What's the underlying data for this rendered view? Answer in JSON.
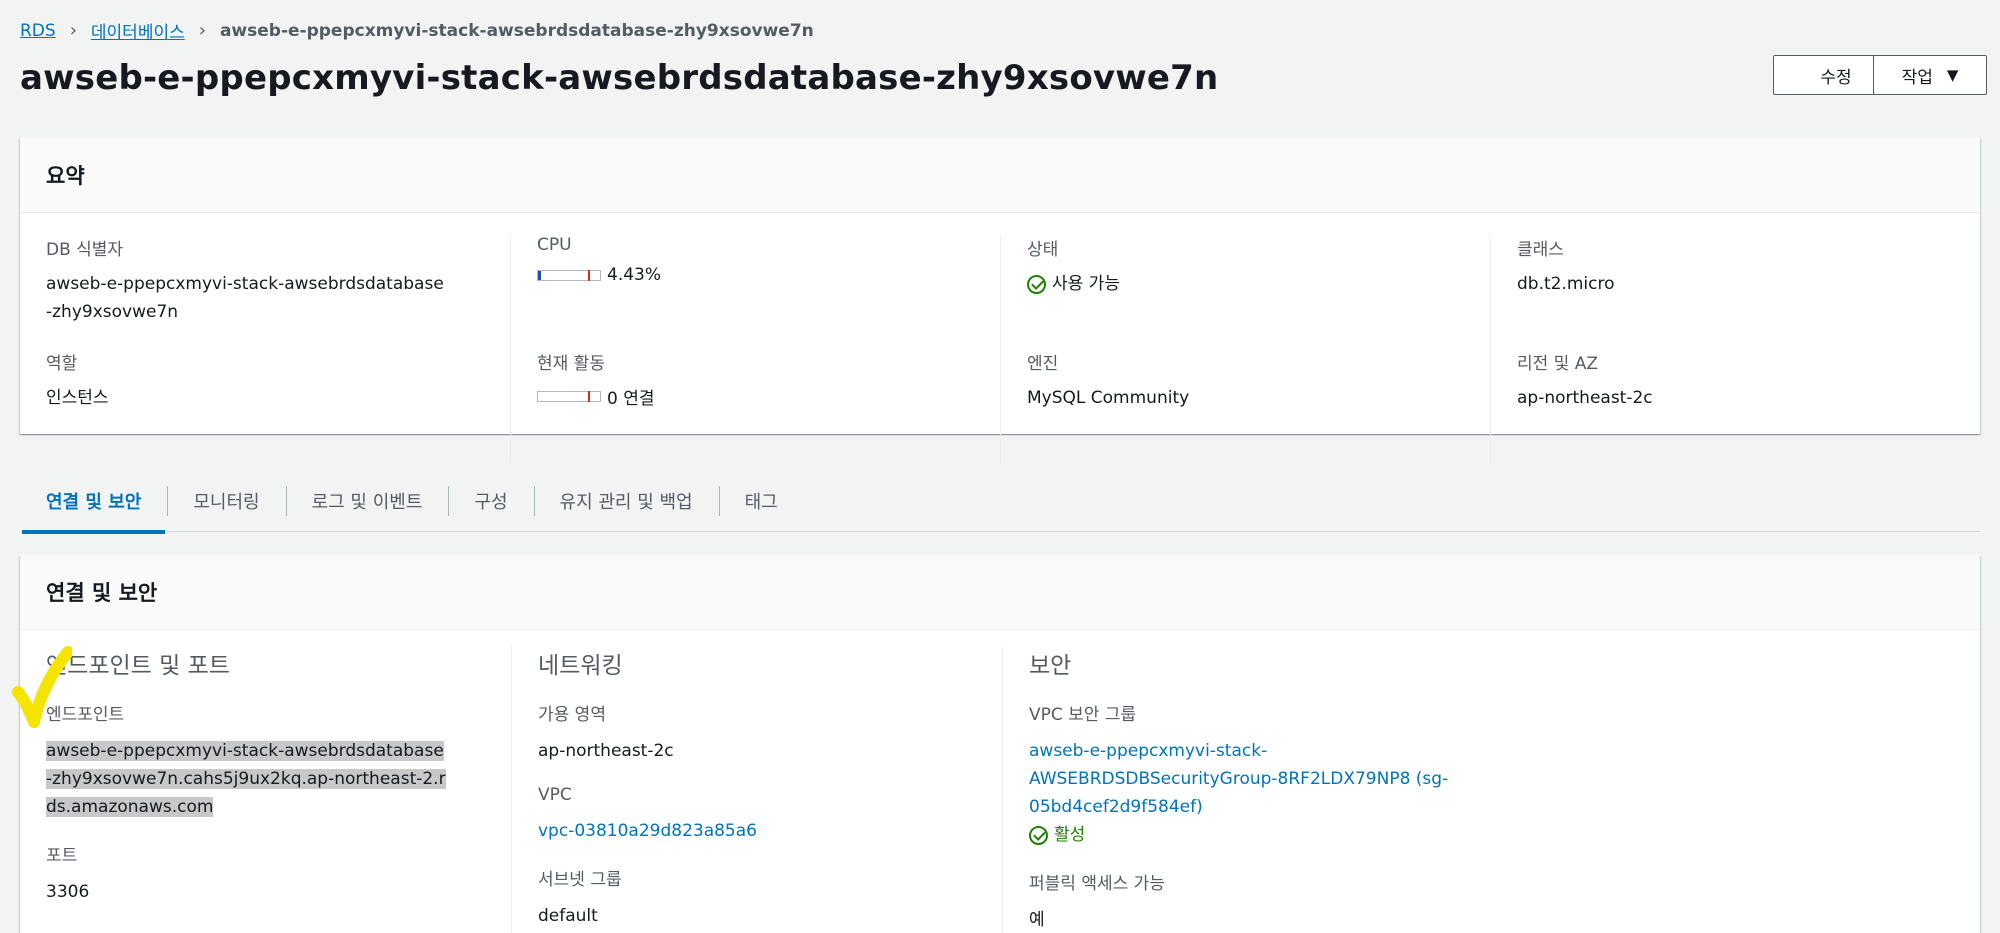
{
  "breadcrumb": {
    "root": "RDS",
    "databases": "데이터베이스",
    "current": "awseb-e-ppepcxmyvi-stack-awsebrdsdatabase-zhy9xsovwe7n"
  },
  "page": {
    "title": "awseb-e-ppepcxmyvi-stack-awsebrdsdatabase-zhy9xsovwe7n"
  },
  "actions": {
    "edit_label": "수정",
    "actions_label": "작업"
  },
  "summary": {
    "header": "요약",
    "db_identifier_label": "DB 식별자",
    "db_identifier_value": "awseb-e-ppepcxmyvi-stack-awsebrdsdatabase-zhy9xsovwe7n",
    "role_label": "역할",
    "role_value": "인스턴스",
    "cpu_label": "CPU",
    "cpu_value": "4.43%",
    "cpu_fraction": 0.0443,
    "activity_label": "현재 활동",
    "activity_value": "0 연결",
    "activity_fraction": 0,
    "status_label": "상태",
    "status_value": "사용 가능",
    "engine_label": "엔진",
    "engine_value": "MySQL Community",
    "class_label": "클래스",
    "class_value": "db.t2.micro",
    "region_label": "리전 및 AZ",
    "region_value": "ap-northeast-2c"
  },
  "tabs": [
    {
      "label": "연결 및 보안",
      "active": true
    },
    {
      "label": "모니터링"
    },
    {
      "label": "로그 및 이벤트"
    },
    {
      "label": "구성"
    },
    {
      "label": "유지 관리 및 백업"
    },
    {
      "label": "태그"
    }
  ],
  "connectivity": {
    "header": "연결 및 보안",
    "endpoint_section": "엔드포인트 및 포트",
    "endpoint_label": "엔드포인트",
    "endpoint_value": "awseb-e-ppepcxmyvi-stack-awsebrdsdatabase-zhy9xsovwe7n.cahs5j9ux2kq.ap-northeast-2.rds.amazonaws.com",
    "port_label": "포트",
    "port_value": "3306",
    "network_section": "네트워킹",
    "az_label": "가용 영역",
    "az_value": "ap-northeast-2c",
    "vpc_label": "VPC",
    "vpc_value": "vpc-03810a29d823a85a6",
    "subnet_label": "서브넷 그룹",
    "subnet_value": "default",
    "security_section": "보안",
    "sg_label": "VPC 보안 그룹",
    "sg_value": "awseb-e-ppepcxmyvi-stack-AWSEBRDSDBSecurityGroup-8RF2LDX79NP8 (sg-05bd4cef2d9f584ef)",
    "sg_status": "활성",
    "public_label": "퍼블릭 액세스 가능",
    "public_value": "예"
  },
  "colors": {
    "link": "#0073bb",
    "success": "#1d8102",
    "annotation": "#f5e400"
  }
}
